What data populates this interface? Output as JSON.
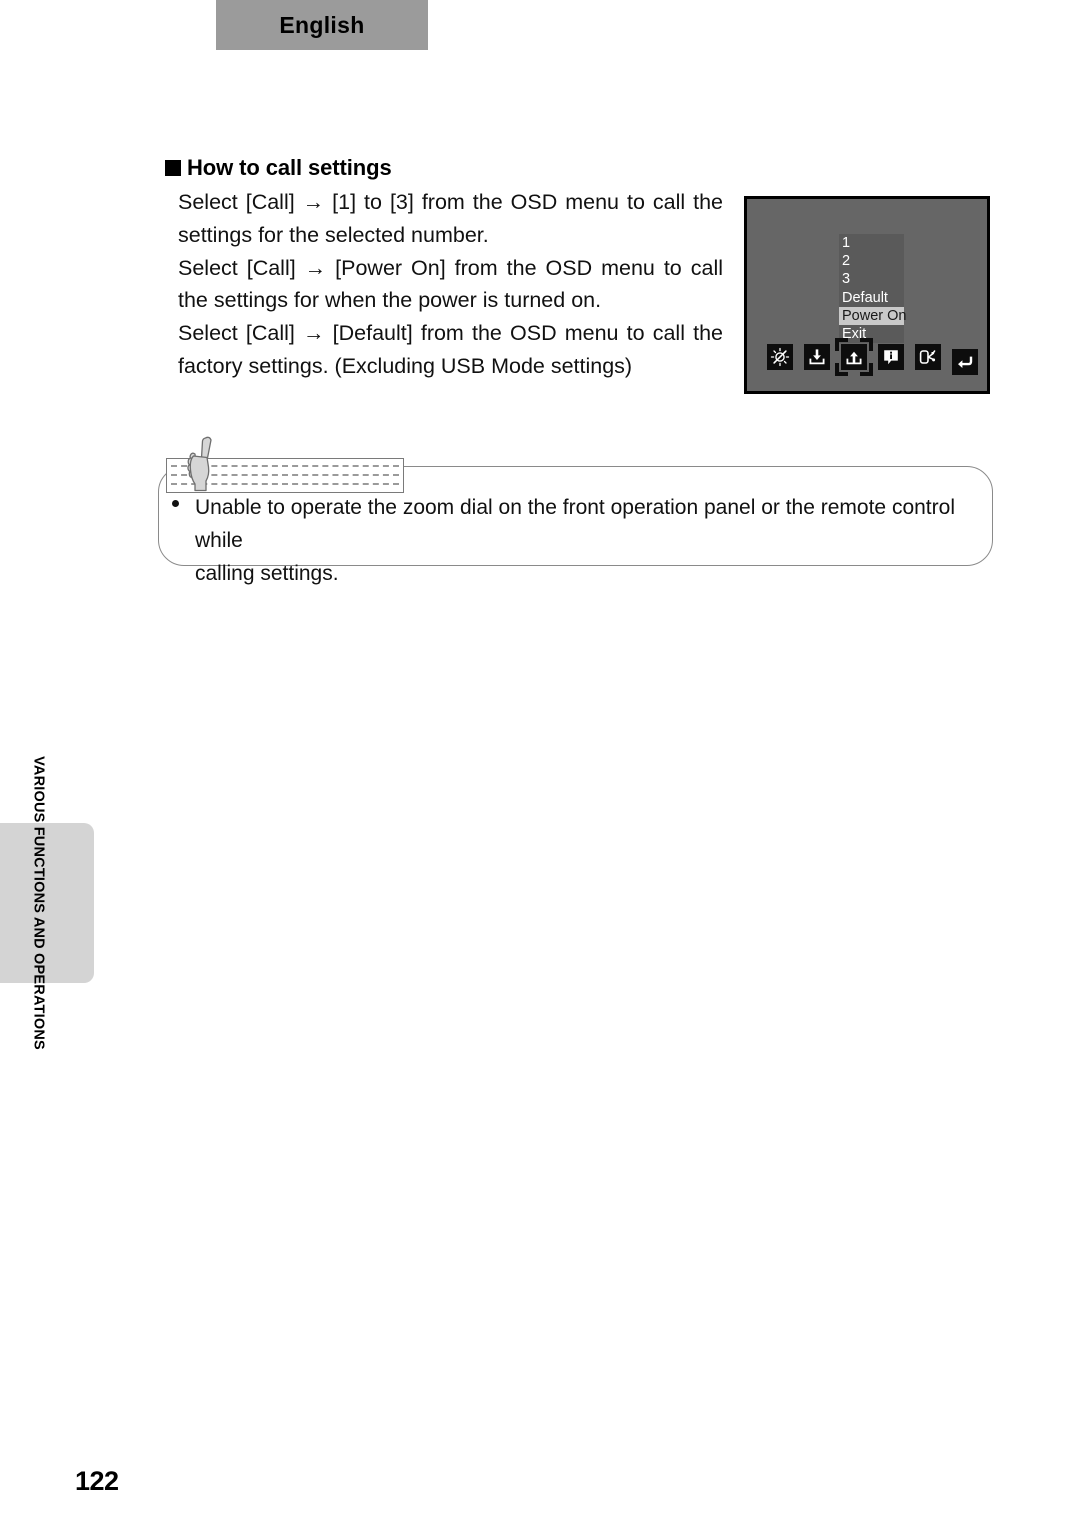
{
  "header": {
    "language_tab": "English"
  },
  "section": {
    "bullet": "black-square",
    "heading": "How to call settings",
    "paragraphs": [
      "Select [Call] → [1] to [3] from the OSD menu to call the settings for the selected number.",
      "Select [Call] → [Power On] from the OSD menu to call the settings for when the power is turned on.",
      "Select [Call] → [Default] from the OSD menu to call the factory settings. (Excluding USB Mode settings)"
    ]
  },
  "osd": {
    "menu_items": [
      {
        "label": "1",
        "selected": false
      },
      {
        "label": "2",
        "selected": false
      },
      {
        "label": "3",
        "selected": false
      },
      {
        "label": "Default",
        "selected": false
      },
      {
        "label": "Power On",
        "selected": true
      },
      {
        "label": "Exit",
        "selected": false
      }
    ],
    "icons": [
      {
        "name": "brightness-adjust-icon",
        "selected": false
      },
      {
        "name": "save-download-icon",
        "selected": false
      },
      {
        "name": "call-upload-icon",
        "selected": true
      },
      {
        "name": "info-icon",
        "selected": false
      },
      {
        "name": "usb-mode-icon",
        "selected": false
      },
      {
        "name": "return-icon",
        "selected": false
      }
    ],
    "colors": {
      "screen_background": "#666666",
      "menu_background": "#5a5a5a",
      "menu_text": "#ffffff",
      "selected_background": "#c9c9c9",
      "selected_text": "#1a1a1a",
      "icon_background": "#0d0d0d",
      "icon_glyph": "#ffffff",
      "screen_border": "#000000"
    }
  },
  "note": {
    "icon": "pointing-hand-memo-icon",
    "bullet": "•",
    "lines": [
      "Unable to operate the zoom dial on the front operation panel or the remote control while",
      "calling settings."
    ]
  },
  "side_tab": {
    "label": "VARIOUS FUNCTIONS AND OPERATIONS",
    "color": "#d4d4d4"
  },
  "footer": {
    "page_number": "122"
  }
}
